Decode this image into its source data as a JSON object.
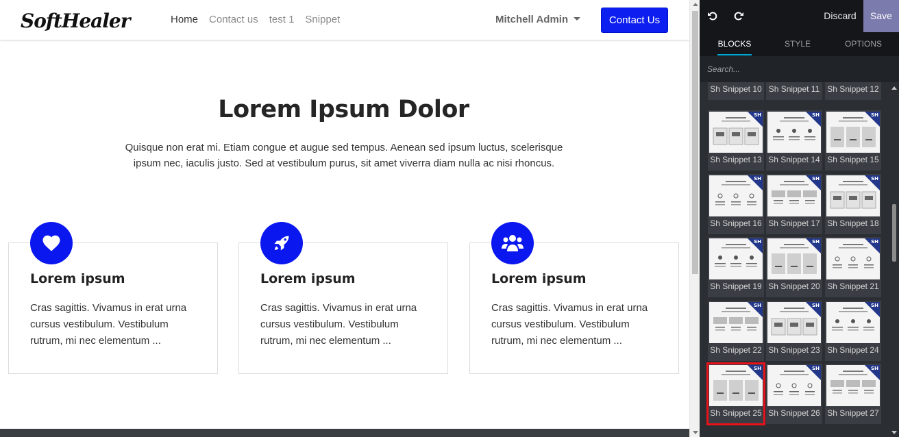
{
  "nav": {
    "logo_text": "SoftHealer",
    "links": [
      "Home",
      "Contact us",
      "test 1",
      "Snippet"
    ],
    "active_link": "Home",
    "user_name": "Mitchell Admin",
    "cta_label": "Contact Us"
  },
  "hero": {
    "title": "Lorem Ipsum Dolor",
    "description": "Quisque non erat mi. Etiam congue et augue sed tempus. Aenean sed ipsum luctus, scelerisque ipsum nec, iaculis justo. Sed at vestibulum purus, sit amet viverra diam nulla ac nisi rhoncus."
  },
  "features": [
    {
      "icon": "heart-icon",
      "title": "Lorem ipsum",
      "text": "Cras sagittis. Vivamus in erat urna cursus vestibulum. Vestibulum rutrum, mi nec elementum ..."
    },
    {
      "icon": "rocket-icon",
      "title": "Lorem ipsum",
      "text": "Cras sagittis. Vivamus in erat urna cursus vestibulum. Vestibulum rutrum, mi nec elementum ..."
    },
    {
      "icon": "users-icon",
      "title": "Lorem ipsum",
      "text": "Cras sagittis. Vivamus in erat urna cursus vestibulum. Vestibulum rutrum, mi nec elementum ..."
    }
  ],
  "editor": {
    "discard_label": "Discard",
    "save_label": "Save",
    "tabs": [
      "BLOCKS",
      "STYLE",
      "OPTIONS"
    ],
    "active_tab": "BLOCKS",
    "search_placeholder": "Search...",
    "badge_text": "SH",
    "snippets": [
      "Sh Snippet 10",
      "Sh Snippet 11",
      "Sh Snippet 12",
      "Sh Snippet 13",
      "Sh Snippet 14",
      "Sh Snippet 15",
      "Sh Snippet 16",
      "Sh Snippet 17",
      "Sh Snippet 18",
      "Sh Snippet 19",
      "Sh Snippet 20",
      "Sh Snippet 21",
      "Sh Snippet 22",
      "Sh Snippet 23",
      "Sh Snippet 24",
      "Sh Snippet 25",
      "Sh Snippet 26",
      "Sh Snippet 27"
    ],
    "selected_snippet": "Sh Snippet 25"
  },
  "colors": {
    "brand_blue": "#0a17ef",
    "editor_bg": "#2b2e33",
    "save_bg": "#7c7bad",
    "selection": "#e8121a"
  }
}
